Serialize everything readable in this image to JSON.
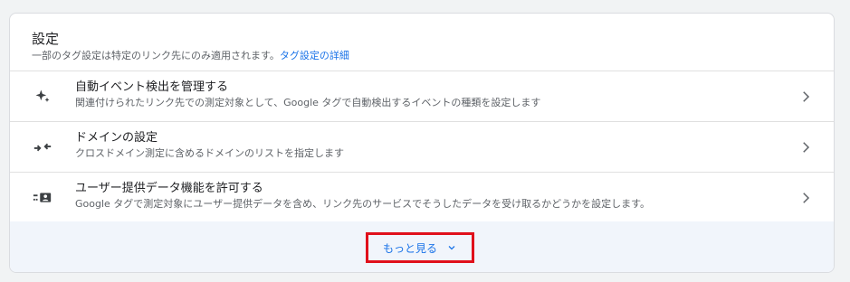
{
  "settings": {
    "title": "設定",
    "subtitle": "一部のタグ設定は特定のリンク先にのみ適用されます。",
    "subtitle_link": "タグ設定の詳細",
    "items": [
      {
        "title": "自動イベント検出を管理する",
        "description": "関連付けられたリンク先での測定対象として、Google タグで自動検出するイベントの種類を設定します",
        "icon": "sparkle-icon"
      },
      {
        "title": "ドメインの設定",
        "description": "クロスドメイン測定に含めるドメインのリストを指定します",
        "icon": "arrows-inward-icon"
      },
      {
        "title": "ユーザー提供データ機能を許可する",
        "description": "Google タグで測定対象にユーザー提供データを含め、リンク先のサービスでそうしたデータを受け取るかどうかを設定します。",
        "icon": "user-data-icon"
      }
    ],
    "more_label": "もっと見る"
  },
  "colors": {
    "accent": "#1a73e8",
    "highlight_border": "#e0101b",
    "footer_bg": "#f1f5fb"
  }
}
